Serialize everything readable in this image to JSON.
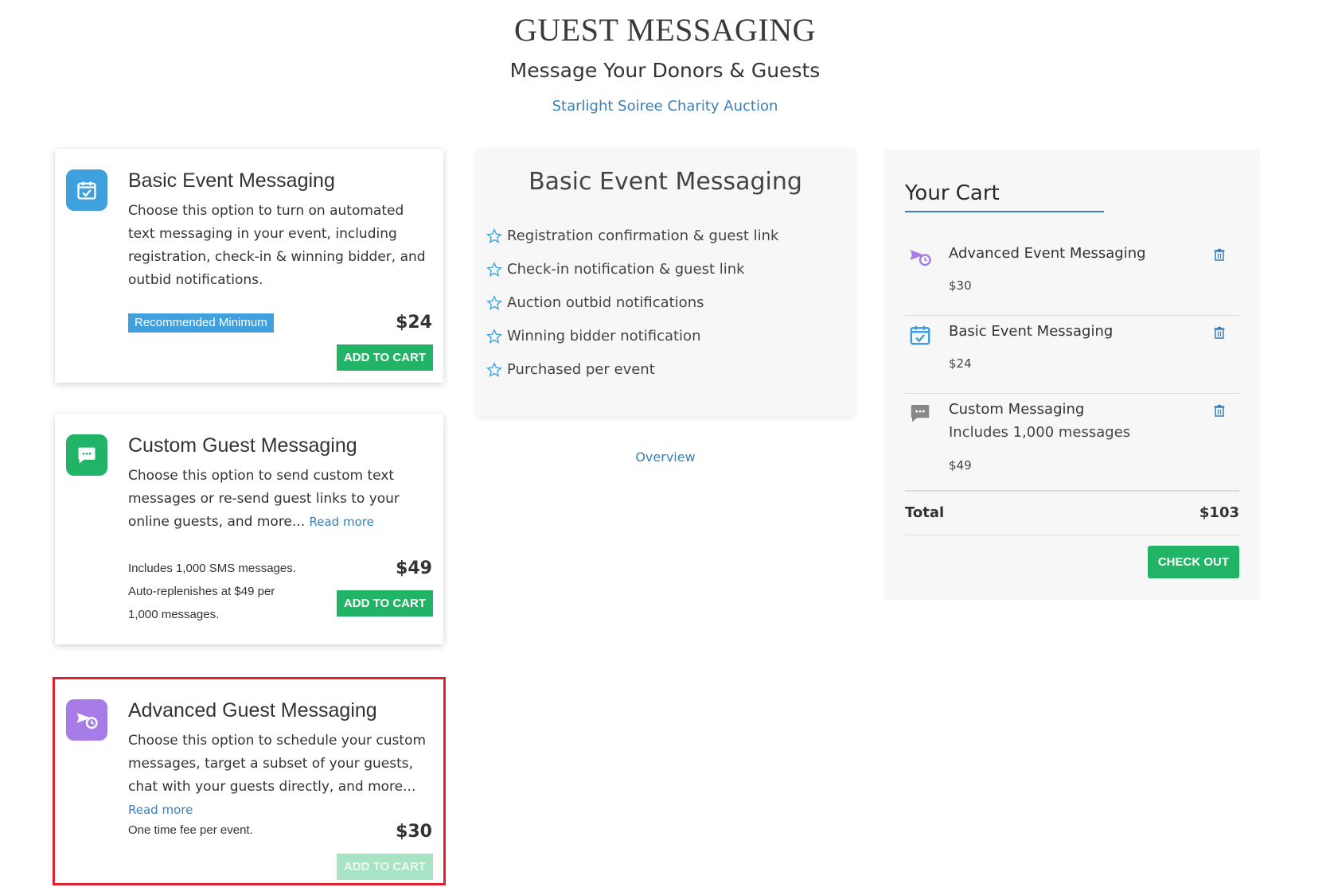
{
  "header": {
    "title": "GUEST MESSAGING",
    "subtitle": "Message Your Donors & Guests",
    "event_name": "Starlight Soiree Charity Auction"
  },
  "products": [
    {
      "title": "Basic Event Messaging",
      "description": "Choose this option to turn on automated text messaging in your event, including registration, check-in & winning bidder, and outbid notifications.",
      "badge": "Recommended Minimum",
      "price": "$24",
      "button_label": "ADD TO CART",
      "icon": "calendar-check-icon",
      "icon_color": "#3ea0dc"
    },
    {
      "title": "Custom Guest Messaging",
      "description": "Choose this option to send custom text messages or re-send guest links to your online guests, and more...",
      "read_more": "Read more",
      "note": "Includes 1,000 SMS messages. Auto-replenishes at $49 per 1,000 messages.",
      "price": "$49",
      "button_label": "ADD TO CART",
      "icon": "chat-bubble-icon",
      "icon_color": "#21b466"
    },
    {
      "title": "Advanced Guest Messaging",
      "description": "Choose this option to schedule your custom messages, target a subset of your guests, chat with your guests directly, and more...",
      "read_more": "Read more",
      "note": "One time fee per event.",
      "price": "$30",
      "button_label": "ADD TO CART",
      "button_disabled": true,
      "icon": "scheduled-send-icon",
      "icon_color": "#a77be8"
    }
  ],
  "features_panel": {
    "title": "Basic Event Messaging",
    "items": [
      "Registration confirmation & guest link",
      "Check-in notification & guest link",
      "Auction outbid notifications",
      "Winning bidder notification",
      "Purchased per event"
    ],
    "overview_link": "Overview"
  },
  "cart": {
    "title": "Your Cart",
    "items": [
      {
        "name": "Advanced Event Messaging",
        "sub": "",
        "price": "$30",
        "icon": "scheduled-send-icon"
      },
      {
        "name": "Basic Event Messaging",
        "sub": "",
        "price": "$24",
        "icon": "calendar-check-icon"
      },
      {
        "name": "Custom Messaging",
        "sub": "Includes 1,000 messages",
        "price": "$49",
        "icon": "chat-bubble-icon"
      }
    ],
    "total_label": "Total",
    "total_value": "$103",
    "checkout_label": "CHECK OUT"
  },
  "colors": {
    "accent_green": "#21b466",
    "link_blue": "#3b7fb5",
    "highlight_red": "#e0202a"
  }
}
